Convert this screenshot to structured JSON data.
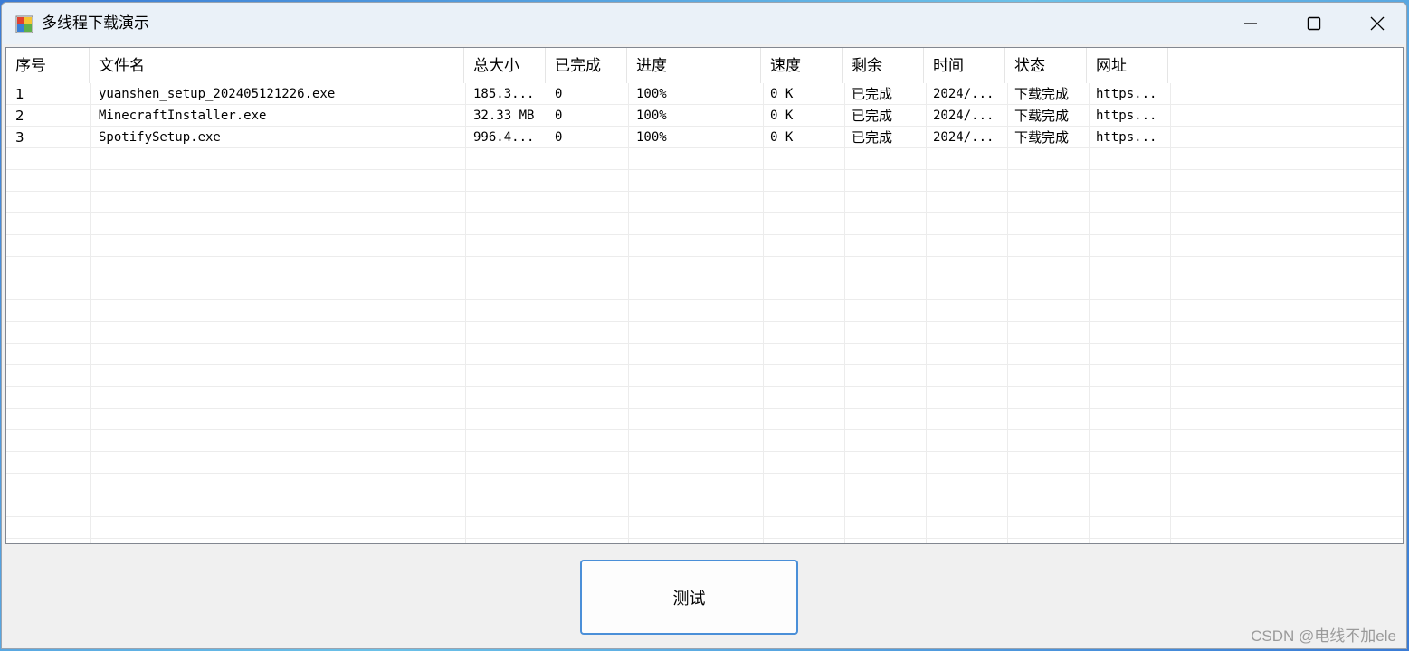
{
  "window": {
    "title": "多线程下载演示"
  },
  "listview": {
    "columns": [
      {
        "key": "index",
        "label": "序号"
      },
      {
        "key": "filename",
        "label": "文件名"
      },
      {
        "key": "size",
        "label": "总大小"
      },
      {
        "key": "done",
        "label": "已完成"
      },
      {
        "key": "progress",
        "label": "进度"
      },
      {
        "key": "speed",
        "label": "速度"
      },
      {
        "key": "remaining",
        "label": "剩余"
      },
      {
        "key": "time",
        "label": "时间"
      },
      {
        "key": "status",
        "label": "状态"
      },
      {
        "key": "url",
        "label": "网址"
      }
    ],
    "rows": [
      [
        "1",
        "yuanshen_setup_202405121226.exe",
        "185.3...",
        "0",
        "100%",
        "0 K",
        "已完成",
        "2024/...",
        "下载完成",
        "https..."
      ],
      [
        "2",
        "MinecraftInstaller.exe",
        "32.33 MB",
        "0",
        "100%",
        "0 K",
        "已完成",
        "2024/...",
        "下载完成",
        "https..."
      ],
      [
        "3",
        "SpotifySetup.exe",
        "996.4...",
        "0",
        "100%",
        "0 K",
        "已完成",
        "2024/...",
        "下载完成",
        "https..."
      ]
    ]
  },
  "buttons": {
    "test_label": "测试"
  },
  "watermark": "CSDN @电线不加ele",
  "icons": {
    "app": "app-window-icon",
    "minimize": "minimize-icon",
    "maximize": "maximize-icon",
    "close": "close-icon"
  },
  "colors": {
    "button_border": "#4a8fd8",
    "titlebar": "#eaf1f8"
  }
}
